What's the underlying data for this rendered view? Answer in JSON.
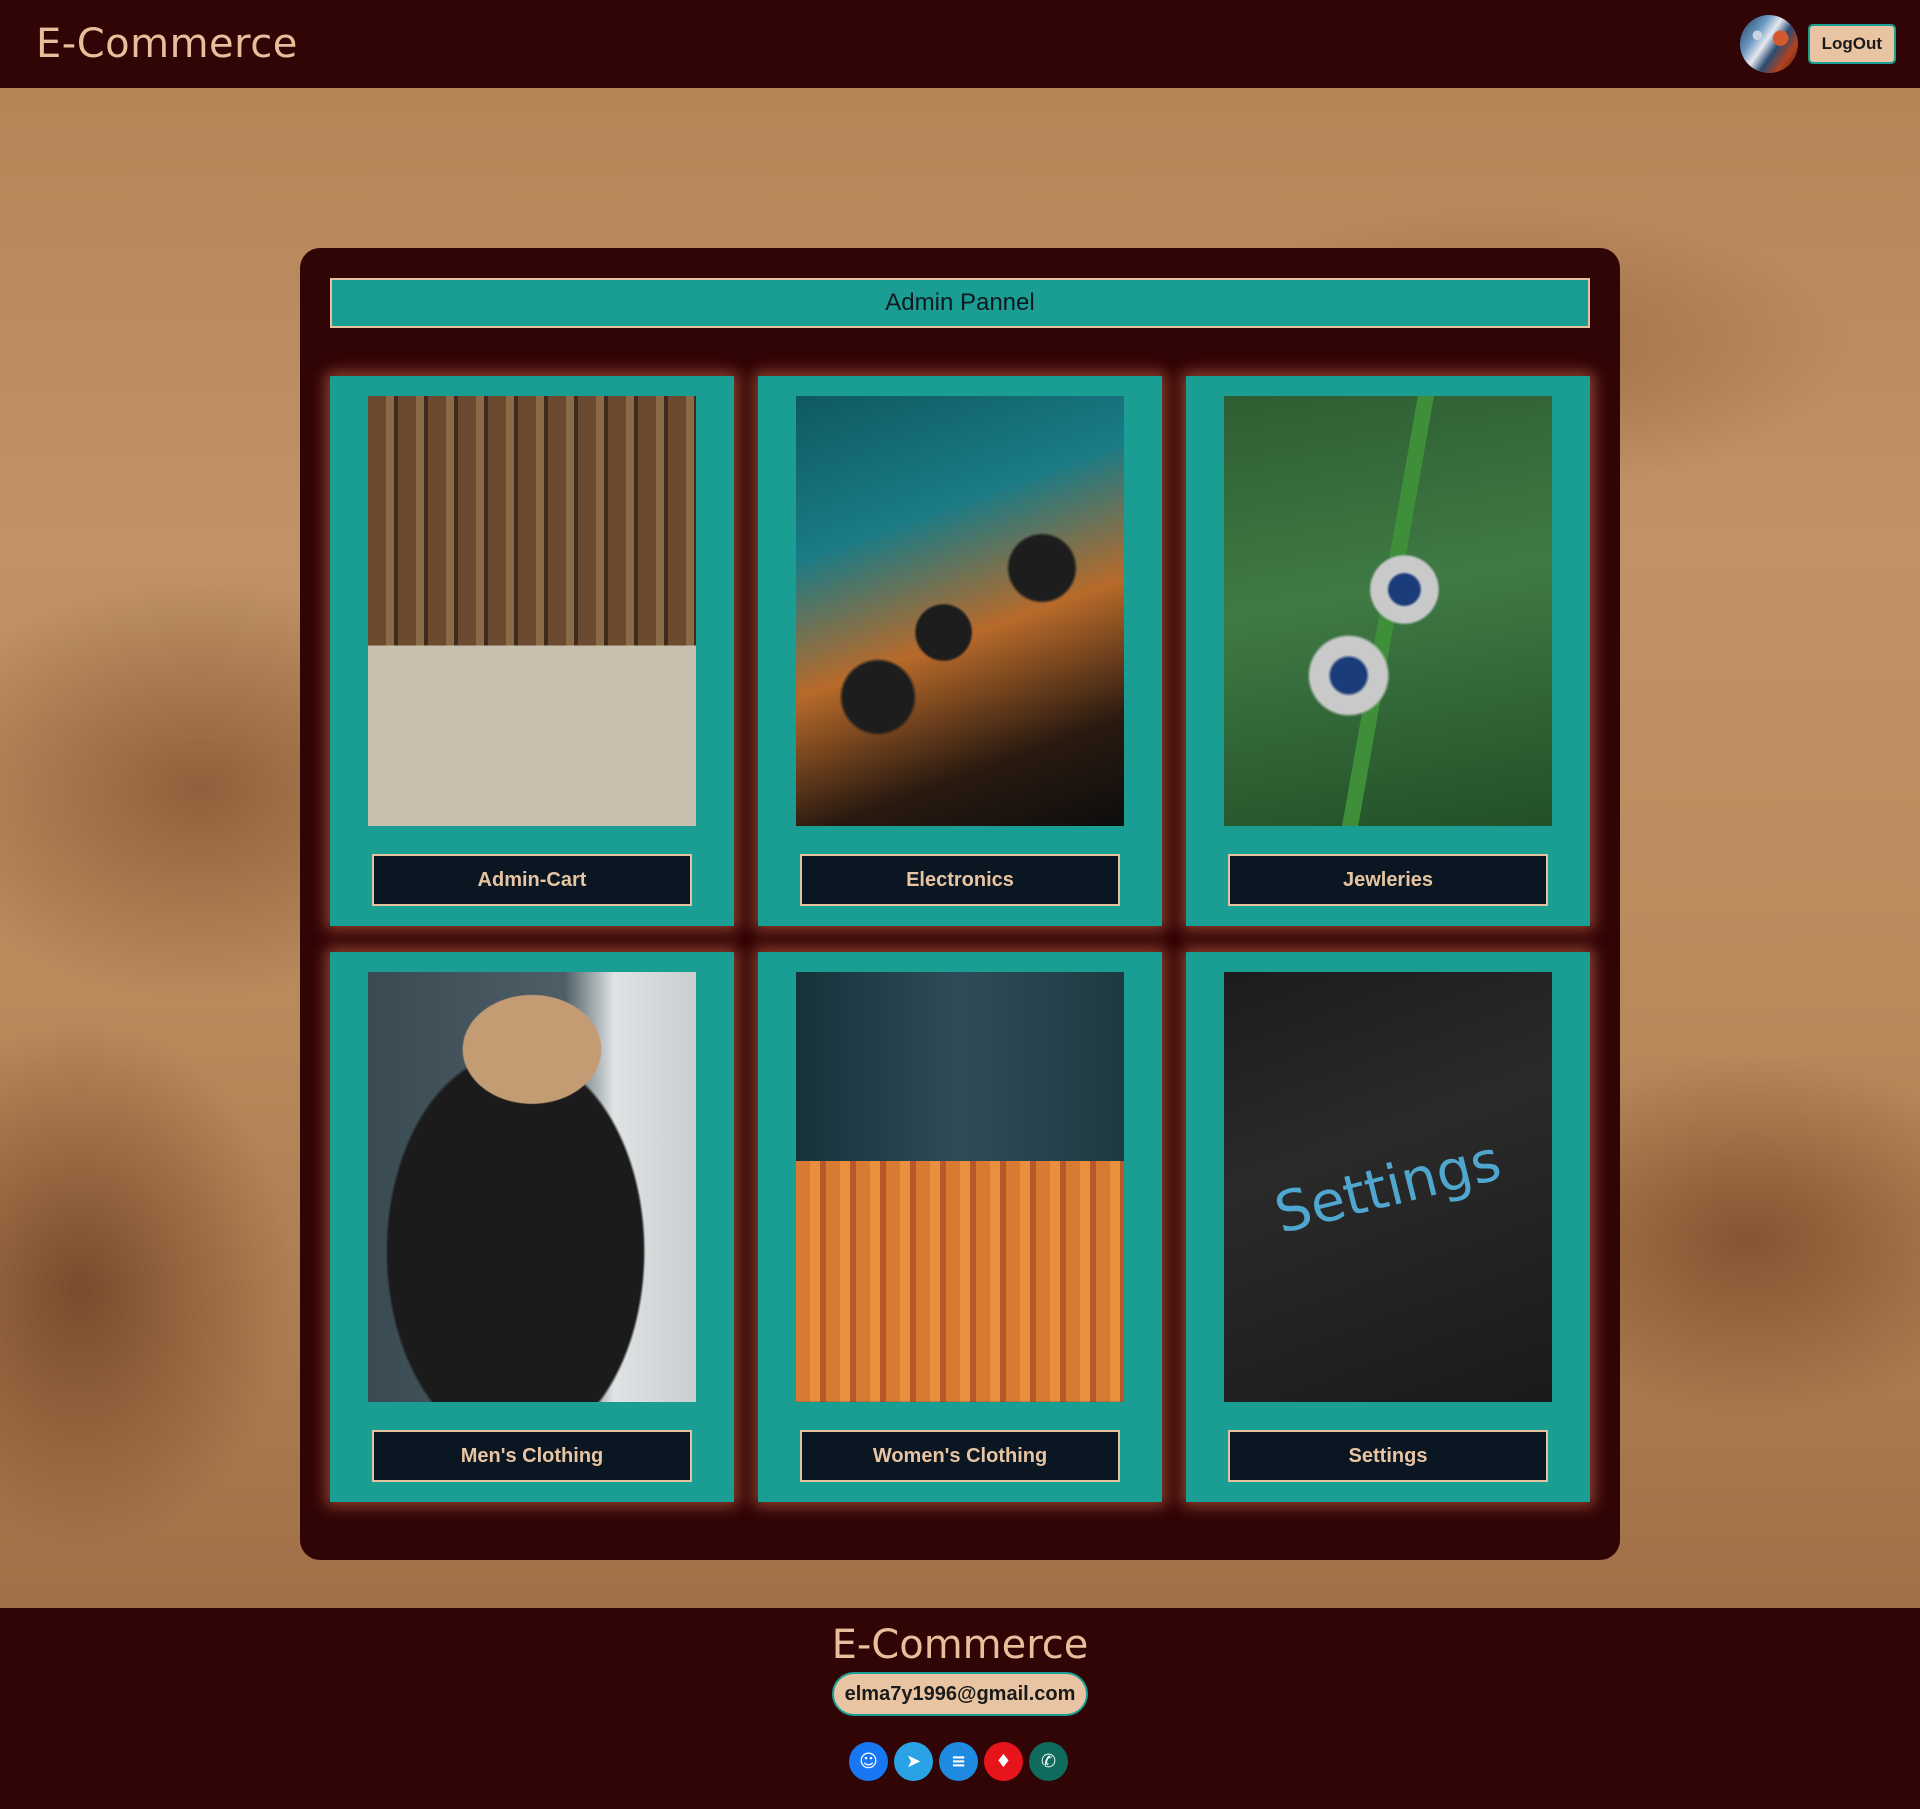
{
  "header": {
    "brand": "E-Commerce",
    "logout_label": "LogOut"
  },
  "panel": {
    "title": "Admin Pannel",
    "cards": [
      {
        "label": "Admin-Cart",
        "image": "shopping-cart-image"
      },
      {
        "label": "Electronics",
        "image": "electronics-image"
      },
      {
        "label": "Jewleries",
        "image": "jewelry-image"
      },
      {
        "label": "Men's Clothing",
        "image": "mens-clothing-image"
      },
      {
        "label": "Women's Clothing",
        "image": "womens-clothing-image"
      },
      {
        "label": "Settings",
        "image": "settings-image"
      }
    ],
    "settings_image_text": "Settings"
  },
  "footer": {
    "brand": "E-Commerce",
    "email": "elma7y1996@gmail.com",
    "social_icons": [
      {
        "name": "messenger-icon",
        "glyph": "☺",
        "color": "#1877f2"
      },
      {
        "name": "telegram-icon",
        "glyph": "➤",
        "color": "#2aa3e6"
      },
      {
        "name": "linkedin-icon",
        "glyph": "≡",
        "color": "#1f8be0"
      },
      {
        "name": "pinterest-icon",
        "glyph": "♦",
        "color": "#e8141b"
      },
      {
        "name": "whatsapp-icon",
        "glyph": "✆",
        "color": "#0f6b5c"
      }
    ]
  },
  "colors": {
    "dark_maroon": "#310405",
    "teal": "#1a9e93",
    "tan": "#e8c4a2",
    "navy": "#0a1622"
  }
}
